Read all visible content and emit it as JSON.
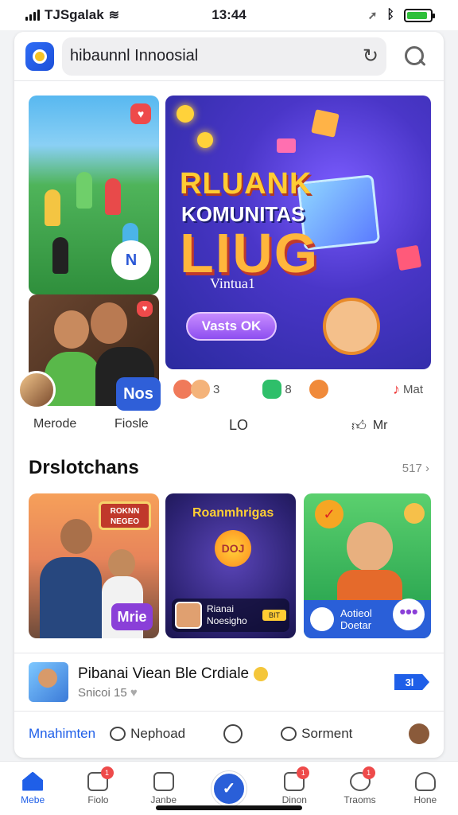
{
  "status_bar": {
    "carrier": "TJSgalak",
    "time": "13:44"
  },
  "header": {
    "search_text": "hibaunnl Innoosial"
  },
  "feed": {
    "game_badge": "N",
    "friends_badge": "Nos",
    "hero": {
      "title_line1": "RLUANK",
      "title_line2": "KOMUNITAS",
      "title_line3": "LIUG",
      "subtitle": "Vintua1",
      "button": "Vasts OK"
    },
    "reactions": [
      {
        "count": "3"
      },
      {
        "count": "8"
      },
      {
        "count": "Mat"
      }
    ],
    "item_labels": [
      "Merode",
      "Fiosle",
      "LO",
      "Mr"
    ]
  },
  "section": {
    "title": "Drslotchans",
    "more": "517",
    "tiles": [
      {
        "sign": "ROKNN NEGEO",
        "badge": "Mrie"
      },
      {
        "title": "Roanmhrigas",
        "coin": "DOJ",
        "caption1": "Rianai",
        "caption2": "Noesigho",
        "pill": "BIT"
      },
      {
        "caption1": "Aotieol",
        "caption2": "Doetar",
        "more": "•••"
      }
    ]
  },
  "promo": {
    "title": "Pibanai Viean Ble Crdiale",
    "subtitle": "Snicoi 15",
    "button": "3l"
  },
  "actions": {
    "first": "Mnahimten",
    "second": "Nephoad",
    "third": "Sorment"
  },
  "bottom_nav": [
    {
      "label": "Mebe"
    },
    {
      "label": "Fiolo",
      "badge": "1"
    },
    {
      "label": "Janbe"
    },
    {
      "label": ""
    },
    {
      "label": "Dinon",
      "badge": "1"
    },
    {
      "label": "Traoms",
      "badge": "1"
    },
    {
      "label": "Hone"
    }
  ],
  "colors": {
    "accent": "#1f5fe8",
    "notification": "#ee4a4a",
    "hero_title": "#ffcc33",
    "badge_purple": "#8a3fd8"
  }
}
